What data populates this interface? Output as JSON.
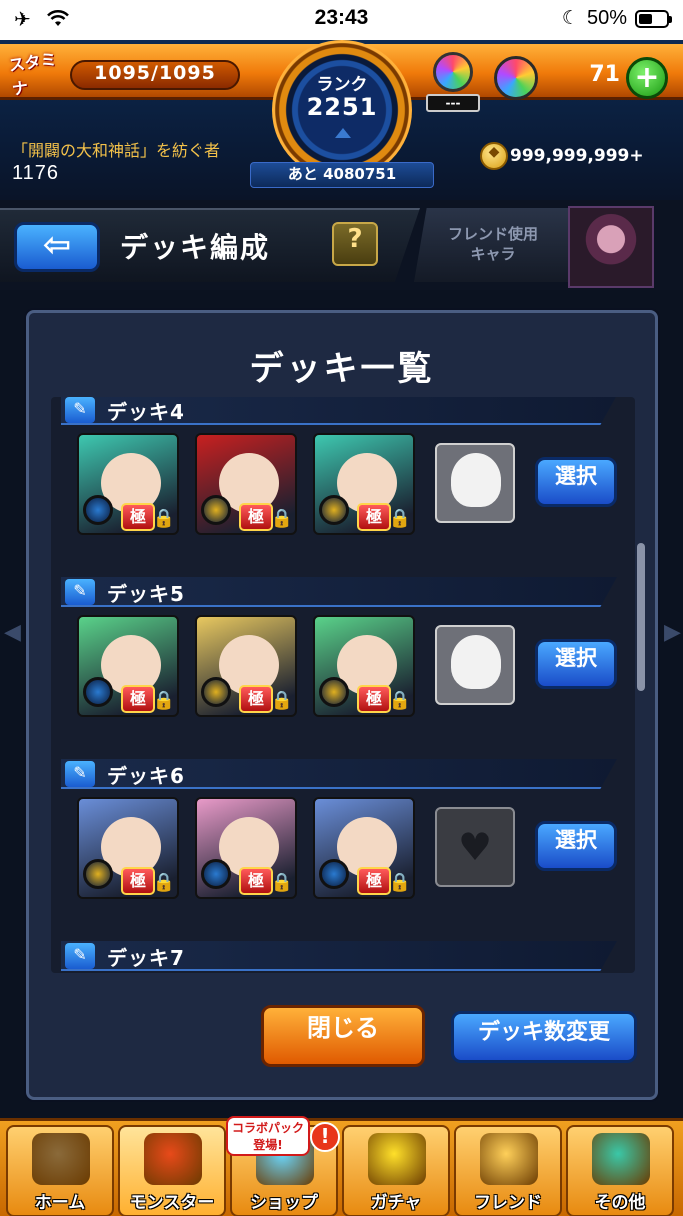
{
  "status_bar": {
    "time": "23:43",
    "battery": "50%",
    "battery_level": 0.5,
    "icons": [
      "airplane-icon",
      "wifi-icon",
      "moon-icon",
      "battery-icon"
    ]
  },
  "header": {
    "stamina_label": "スタミナ",
    "stamina": "1095/1095",
    "rank_label": "ランク",
    "rank": "2251",
    "orb_tag": "---",
    "orb_count": "71",
    "plus_label": "+",
    "title": "「開闢の大和神話」を紡ぐ者",
    "level_value": "1176",
    "exp_remaining": "あと 4080751",
    "coins": "999,999,999+"
  },
  "subheader": {
    "back_label": "⇦",
    "title": "デッキ編成",
    "help_label": "?",
    "friend_label_1": "フレンド使用",
    "friend_label_2": "キャラ"
  },
  "panel": {
    "title": "デッキ一覧",
    "close_label": "閉じる",
    "change_label": "デッキ数変更",
    "decks": [
      {
        "name": "デッキ4",
        "select_label": "選択",
        "monsters": [
          {
            "tag": "極",
            "theme": "#3ec8b0",
            "element": "#2a7ad0"
          },
          {
            "tag": "極",
            "theme": "#c82020",
            "element": "#e0b020"
          },
          {
            "tag": "極",
            "theme": "#3ec8b0",
            "element": "#e0b020"
          }
        ],
        "friend": "cat"
      },
      {
        "name": "デッキ5",
        "select_label": "選択",
        "monsters": [
          {
            "tag": "極",
            "theme": "#5ad28a",
            "element": "#2a7ad0"
          },
          {
            "tag": "極",
            "theme": "#e8c860",
            "element": "#e0b020"
          },
          {
            "tag": "極",
            "theme": "#5ad28a",
            "element": "#e0b020"
          }
        ],
        "friend": "cat"
      },
      {
        "name": "デッキ6",
        "select_label": "選択",
        "monsters": [
          {
            "tag": "極",
            "theme": "#6a8ed8",
            "element": "#e0b020"
          },
          {
            "tag": "極",
            "theme": "#e89ac8",
            "element": "#2a7ad0"
          },
          {
            "tag": "極",
            "theme": "#6a8ed8",
            "element": "#2a7ad0"
          }
        ],
        "friend": "empty"
      },
      {
        "name": "デッキ7"
      }
    ]
  },
  "nav": {
    "items": [
      {
        "label": "ホーム",
        "color": "#8a6a3a"
      },
      {
        "label": "モンスター",
        "color": "#e84a1a"
      },
      {
        "label": "ショップ",
        "color": "#6ad8ff"
      },
      {
        "label": "ガチャ",
        "color": "#ffe02a"
      },
      {
        "label": "フレンド",
        "color": "#ffd05a"
      },
      {
        "label": "その他",
        "color": "#3ac8a8"
      }
    ],
    "collab_badge_1": "コラボパック",
    "collab_badge_2": "登場!",
    "alert": "!"
  }
}
